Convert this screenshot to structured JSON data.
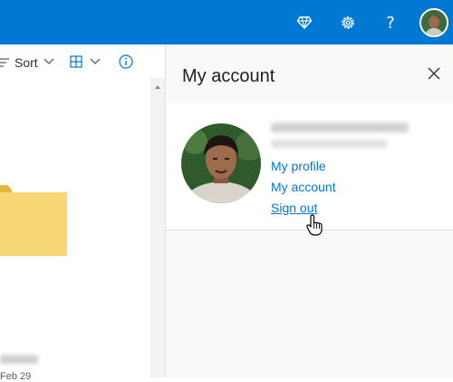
{
  "header": {
    "premium_icon": "diamond-icon",
    "settings_icon": "gear-icon",
    "help_label": "?"
  },
  "toolbar": {
    "sort_label": "Sort"
  },
  "folder": {
    "date": "Feb 29"
  },
  "panel": {
    "title": "My account",
    "links": {
      "profile": "My profile",
      "account": "My account",
      "sign_out": "Sign out"
    }
  },
  "colors": {
    "brand": "#0078d4",
    "folder": "#f8d775",
    "link": "#0078d4"
  }
}
